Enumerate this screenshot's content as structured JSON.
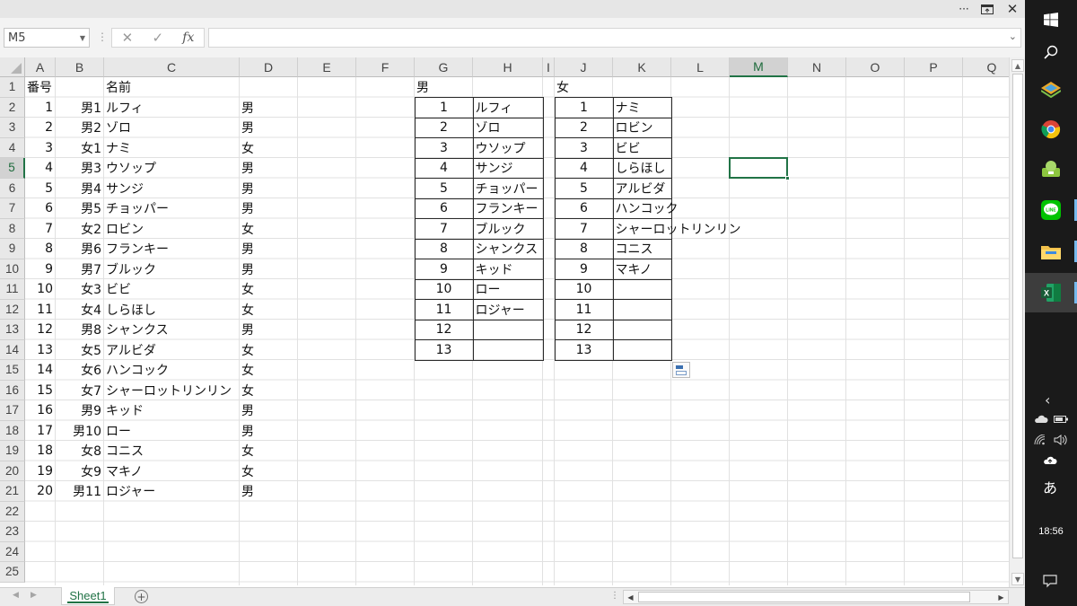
{
  "name_box": {
    "value": "M5"
  },
  "formula": {
    "value": "",
    "fx_label": "fx"
  },
  "columns": [
    "A",
    "B",
    "C",
    "D",
    "E",
    "F",
    "G",
    "H",
    "I",
    "J",
    "K",
    "L",
    "M",
    "N",
    "O",
    "P",
    "Q"
  ],
  "selected_column": "M",
  "rows": [
    "1",
    "2",
    "3",
    "4",
    "5",
    "6",
    "7",
    "8",
    "9",
    "10",
    "11",
    "12",
    "13",
    "14",
    "15",
    "16",
    "17",
    "18",
    "19",
    "20",
    "21",
    "22",
    "23",
    "24",
    "25"
  ],
  "selected_row": "5",
  "main_table": {
    "header": {
      "A": "番号",
      "C": "名前"
    },
    "rows": [
      {
        "A": "1",
        "B": "男1",
        "C": "ルフィ",
        "D": "男"
      },
      {
        "A": "2",
        "B": "男2",
        "C": "ゾロ",
        "D": "男"
      },
      {
        "A": "3",
        "B": "女1",
        "C": "ナミ",
        "D": "女"
      },
      {
        "A": "4",
        "B": "男3",
        "C": "ウソップ",
        "D": "男"
      },
      {
        "A": "5",
        "B": "男4",
        "C": "サンジ",
        "D": "男"
      },
      {
        "A": "6",
        "B": "男5",
        "C": "チョッパー",
        "D": "男"
      },
      {
        "A": "7",
        "B": "女2",
        "C": "ロビン",
        "D": "女"
      },
      {
        "A": "8",
        "B": "男6",
        "C": "フランキー",
        "D": "男"
      },
      {
        "A": "9",
        "B": "男7",
        "C": "ブルック",
        "D": "男"
      },
      {
        "A": "10",
        "B": "女3",
        "C": "ビビ",
        "D": "女"
      },
      {
        "A": "11",
        "B": "女4",
        "C": "しらほし",
        "D": "女"
      },
      {
        "A": "12",
        "B": "男8",
        "C": "シャンクス",
        "D": "男"
      },
      {
        "A": "13",
        "B": "女5",
        "C": "アルビダ",
        "D": "女"
      },
      {
        "A": "14",
        "B": "女6",
        "C": "ハンコック",
        "D": "女"
      },
      {
        "A": "15",
        "B": "女7",
        "C": "シャーロットリンリン",
        "D": "女"
      },
      {
        "A": "16",
        "B": "男9",
        "C": "キッド",
        "D": "男"
      },
      {
        "A": "17",
        "B": "男10",
        "C": "ロー",
        "D": "男"
      },
      {
        "A": "18",
        "B": "女8",
        "C": "コニス",
        "D": "女"
      },
      {
        "A": "19",
        "B": "女9",
        "C": "マキノ",
        "D": "女"
      },
      {
        "A": "20",
        "B": "男11",
        "C": "ロジャー",
        "D": "男"
      }
    ]
  },
  "male_table": {
    "title": "男",
    "rows": [
      {
        "n": "1",
        "name": "ルフィ"
      },
      {
        "n": "2",
        "name": "ゾロ"
      },
      {
        "n": "3",
        "name": "ウソップ"
      },
      {
        "n": "4",
        "name": "サンジ"
      },
      {
        "n": "5",
        "name": "チョッパー"
      },
      {
        "n": "6",
        "name": "フランキー"
      },
      {
        "n": "7",
        "name": "ブルック"
      },
      {
        "n": "8",
        "name": "シャンクス"
      },
      {
        "n": "9",
        "name": "キッド"
      },
      {
        "n": "10",
        "name": "ロー"
      },
      {
        "n": "11",
        "name": "ロジャー"
      },
      {
        "n": "12",
        "name": ""
      },
      {
        "n": "13",
        "name": ""
      }
    ]
  },
  "female_table": {
    "title": "女",
    "rows": [
      {
        "n": "1",
        "name": "ナミ"
      },
      {
        "n": "2",
        "name": "ロビン"
      },
      {
        "n": "3",
        "name": "ビビ"
      },
      {
        "n": "4",
        "name": "しらほし"
      },
      {
        "n": "5",
        "name": "アルビダ"
      },
      {
        "n": "6",
        "name": "ハンコック"
      },
      {
        "n": "7",
        "name": "シャーロットリンリン"
      },
      {
        "n": "8",
        "name": "コニス"
      },
      {
        "n": "9",
        "name": "マキノ"
      },
      {
        "n": "10",
        "name": ""
      },
      {
        "n": "11",
        "name": ""
      },
      {
        "n": "12",
        "name": ""
      },
      {
        "n": "13",
        "name": ""
      }
    ]
  },
  "sheet_tab": {
    "label": "Sheet1"
  },
  "taskbar": {
    "time": "18:56",
    "ime": "あ",
    "apps": [
      "windows-start-icon",
      "search-icon",
      "app-icon",
      "chrome-icon",
      "app-icon-2",
      "line-icon",
      "file-explorer-icon",
      "excel-icon"
    ]
  }
}
